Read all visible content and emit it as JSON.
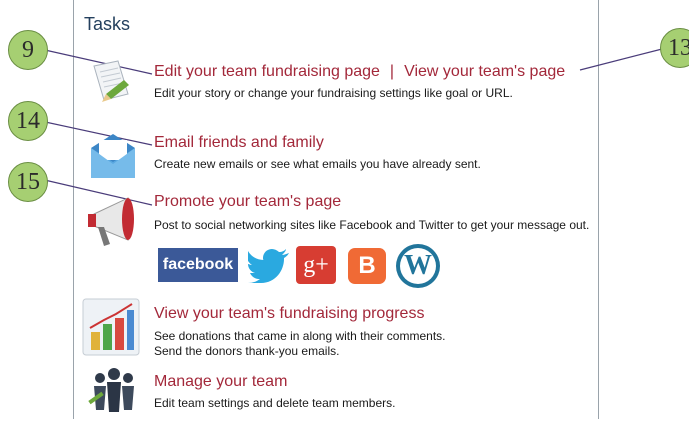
{
  "panel": {
    "title": "Tasks"
  },
  "callouts": {
    "c9": "9",
    "c13": "13",
    "c14": "14",
    "c15": "15"
  },
  "tasks": {
    "edit_page": {
      "title_edit": "Edit your team fundraising page",
      "separator": "|",
      "title_view": "View your team's page",
      "description": "Edit your story or change your fundraising settings like goal or URL."
    },
    "email": {
      "title": "Email friends and family",
      "description": "Create new emails or see what emails you have already sent."
    },
    "promote": {
      "title": "Promote your team's page",
      "description": "Post to social networking sites like Facebook and Twitter to get your message out.",
      "social": {
        "facebook_label": "facebook"
      }
    },
    "progress": {
      "title": "View your team's fundraising progress",
      "description_line1": "See donations that came in along with their comments.",
      "description_line2": "Send the donors thank-you emails."
    },
    "manage": {
      "title": "Manage your team",
      "description": "Edit team settings and delete team members."
    }
  },
  "colors": {
    "link": "#a3283a",
    "callout_fill": "#a6cf72",
    "title": "#24405e",
    "facebook": "#3b5998",
    "twitter": "#2aa9e0",
    "googleplus": "#d73d32",
    "blogger": "#f06a35",
    "wordpress": "#21759b"
  },
  "icons": [
    "document-pencil-icon",
    "envelope-icon",
    "megaphone-icon",
    "facebook-icon",
    "twitter-icon",
    "google-plus-icon",
    "blogger-icon",
    "wordpress-icon",
    "bar-chart-icon",
    "team-people-icon"
  ]
}
